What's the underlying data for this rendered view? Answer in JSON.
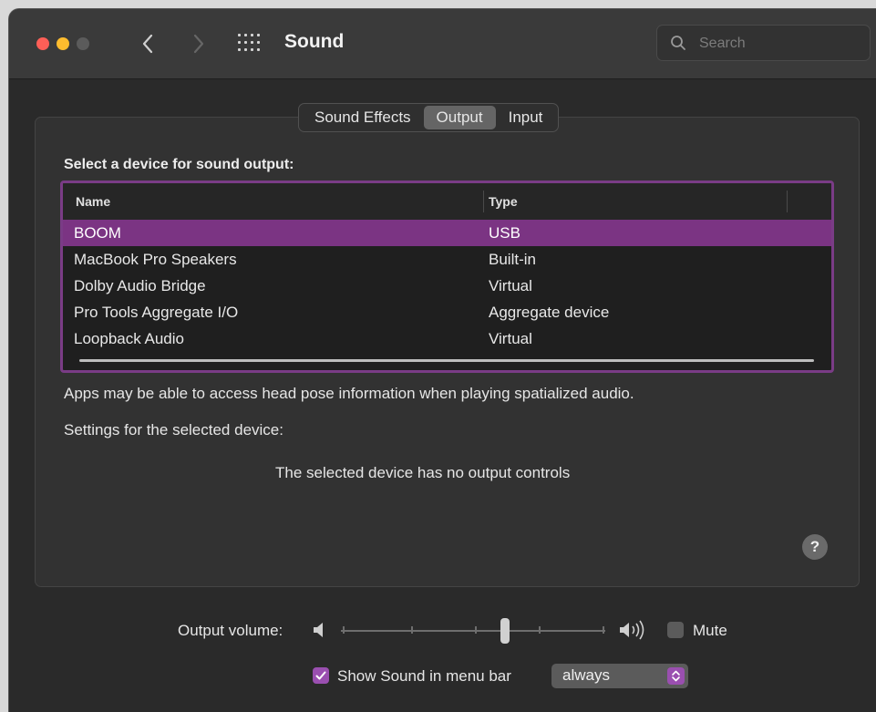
{
  "window": {
    "title": "Sound",
    "search": {
      "placeholder": "Search",
      "value": ""
    }
  },
  "tabs": [
    {
      "label": "Sound Effects",
      "active": false
    },
    {
      "label": "Output",
      "active": true
    },
    {
      "label": "Input",
      "active": false
    }
  ],
  "output": {
    "heading": "Select a device for sound output:",
    "columns": {
      "name": "Name",
      "type": "Type"
    },
    "devices": [
      {
        "name": "BOOM",
        "type": "USB",
        "selected": true
      },
      {
        "name": "MacBook Pro Speakers",
        "type": "Built-in",
        "selected": false
      },
      {
        "name": "Dolby Audio Bridge",
        "type": "Virtual",
        "selected": false
      },
      {
        "name": "Pro Tools Aggregate I/O",
        "type": "Aggregate device",
        "selected": false
      },
      {
        "name": "Loopback Audio",
        "type": "Virtual",
        "selected": false
      }
    ],
    "head_pose_note": "Apps may be able to access head pose information when playing spatialized audio.",
    "settings_label": "Settings for the selected device:",
    "no_controls": "The selected device has no output controls",
    "help": "?"
  },
  "footer": {
    "volume_label": "Output volume:",
    "volume_level": 0.62,
    "mute_label": "Mute",
    "mute_checked": false,
    "show_in_menu_bar_label": "Show Sound in menu bar",
    "show_in_menu_bar_checked": true,
    "menu_bar_option": "always"
  },
  "colors": {
    "selection": "#7b3483",
    "accent": "#9a4fb0",
    "window_bg": "#2a2a2a"
  }
}
